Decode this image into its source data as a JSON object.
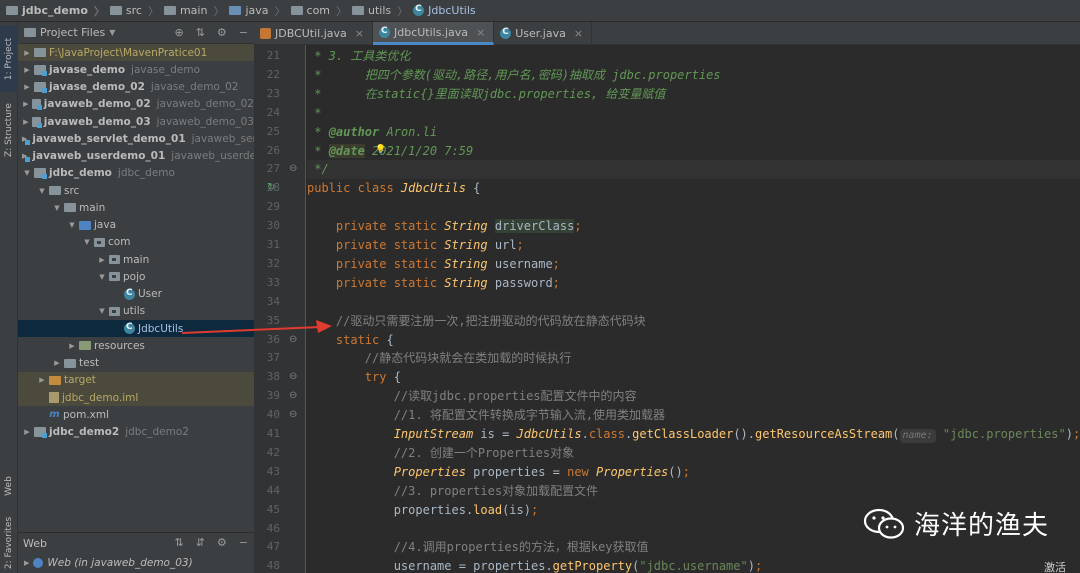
{
  "breadcrumb": [
    "jdbc_demo",
    "src",
    "main",
    "java",
    "com",
    "utils",
    "JdbcUtils"
  ],
  "stripe": {
    "project_tab": "1: Project",
    "structure_tab": "Z: Structure",
    "web_tab": "Web",
    "favorites_tab": "2: Favorites"
  },
  "project_panel": {
    "title": "Project Files",
    "tree": [
      {
        "label": "F:\\JavaProject\\MavenPratice01",
        "module": "",
        "depth": 0,
        "arrow": "right",
        "icon": "folder",
        "bold": false,
        "state": "highlight"
      },
      {
        "label": "javase_demo",
        "module": "javase_demo",
        "depth": 0,
        "arrow": "right",
        "icon": "module",
        "bold": true
      },
      {
        "label": "javase_demo_02",
        "module": "javase_demo_02",
        "depth": 0,
        "arrow": "right",
        "icon": "module",
        "bold": true
      },
      {
        "label": "javaweb_demo_02",
        "module": "javaweb_demo_02",
        "depth": 0,
        "arrow": "right",
        "icon": "module",
        "bold": true
      },
      {
        "label": "javaweb_demo_03",
        "module": "javaweb_demo_03",
        "depth": 0,
        "arrow": "right",
        "icon": "module",
        "bold": true
      },
      {
        "label": "javaweb_servlet_demo_01",
        "module": "javaweb_servle",
        "depth": 0,
        "arrow": "right",
        "icon": "module",
        "bold": true
      },
      {
        "label": "javaweb_userdemo_01",
        "module": "javaweb_userdem",
        "depth": 0,
        "arrow": "right",
        "icon": "module",
        "bold": true
      },
      {
        "label": "jdbc_demo",
        "module": "jdbc_demo",
        "depth": 0,
        "arrow": "down",
        "icon": "module",
        "bold": true
      },
      {
        "label": "src",
        "module": "",
        "depth": 1,
        "arrow": "down",
        "icon": "folder"
      },
      {
        "label": "main",
        "module": "",
        "depth": 2,
        "arrow": "down",
        "icon": "folder"
      },
      {
        "label": "java",
        "module": "",
        "depth": 3,
        "arrow": "down",
        "icon": "folder-blue"
      },
      {
        "label": "com",
        "module": "",
        "depth": 4,
        "arrow": "down",
        "icon": "package"
      },
      {
        "label": "main",
        "module": "",
        "depth": 5,
        "arrow": "right",
        "icon": "package"
      },
      {
        "label": "pojo",
        "module": "",
        "depth": 5,
        "arrow": "down",
        "icon": "package"
      },
      {
        "label": "User",
        "module": "",
        "depth": 6,
        "arrow": "none",
        "icon": "class"
      },
      {
        "label": "utils",
        "module": "",
        "depth": 5,
        "arrow": "down",
        "icon": "package"
      },
      {
        "label": "JdbcUtils",
        "module": "",
        "depth": 6,
        "arrow": "none",
        "icon": "class",
        "state": "selected"
      },
      {
        "label": "resources",
        "module": "",
        "depth": 3,
        "arrow": "right",
        "icon": "folder-res"
      },
      {
        "label": "test",
        "module": "",
        "depth": 2,
        "arrow": "right",
        "icon": "folder"
      },
      {
        "label": "target",
        "module": "",
        "depth": 1,
        "arrow": "right",
        "icon": "folder-orange",
        "state": "highlight"
      },
      {
        "label": "jdbc_demo.iml",
        "module": "",
        "depth": 1,
        "arrow": "none",
        "icon": "iml",
        "state": "highlight"
      },
      {
        "label": "pom.xml",
        "module": "",
        "depth": 1,
        "arrow": "none",
        "icon": "maven"
      },
      {
        "label": "jdbc_demo2",
        "module": "jdbc_demo2",
        "depth": 0,
        "arrow": "right",
        "icon": "module",
        "bold": true
      }
    ]
  },
  "web_panel": {
    "title": "Web",
    "item": "Web (in javaweb_demo_03)"
  },
  "tabs": [
    {
      "label": "JDBCUtil.java",
      "icon": "java-file",
      "active": false
    },
    {
      "label": "JdbcUtils.java",
      "icon": "class",
      "active": true
    },
    {
      "label": "User.java",
      "icon": "class",
      "active": false
    }
  ],
  "editor": {
    "lines": [
      {
        "n": "21",
        "html": "<span class='dc'> * 3. 工具类优化</span>"
      },
      {
        "n": "22",
        "html": "<span class='dc'> *      把四个参数(驱动,路径,用户名,密码)抽取成 jdbc.properties</span>"
      },
      {
        "n": "23",
        "html": "<span class='dc'> *      在static{}里面读取jdbc.properties, 给变量赋值</span>"
      },
      {
        "n": "24",
        "html": "<span class='dc'> *</span>"
      },
      {
        "n": "25",
        "html": "<span class='dc'> * </span><span class='tag'>@author</span><span class='dc'> Aron.li</span>"
      },
      {
        "n": "26",
        "html": "<span class='dc'> * </span><span class='tag' style='background:#3b3b2e'>@date</span><span class='dc'> 2021/1/20 7:59</span>"
      },
      {
        "n": "27",
        "html": "<span class='dc'> */</span>"
      },
      {
        "n": "28",
        "html": "<span class='kw'>public class </span><span class='ity'>JdbcUtils</span> {"
      },
      {
        "n": "29",
        "html": ""
      },
      {
        "n": "30",
        "html": "    <span class='kw'>private static </span><span class='ity'>String</span> <span class='hlvar'>driverClass</span><span class='kw'>;</span>"
      },
      {
        "n": "31",
        "html": "    <span class='kw'>private static </span><span class='ity'>String</span> url<span class='kw'>;</span>"
      },
      {
        "n": "32",
        "html": "    <span class='kw'>private static </span><span class='ity'>String</span> username<span class='kw'>;</span>"
      },
      {
        "n": "33",
        "html": "    <span class='kw'>private static </span><span class='ity'>String</span> password<span class='kw'>;</span>"
      },
      {
        "n": "34",
        "html": ""
      },
      {
        "n": "35",
        "html": "    <span class='cm'>//驱动只需要注册一次,把注册驱动的代码放在静态代码块</span>"
      },
      {
        "n": "36",
        "html": "    <span class='kw'>static</span> {"
      },
      {
        "n": "37",
        "html": "        <span class='cm'>//静态代码块就会在类加载的时候执行</span>"
      },
      {
        "n": "38",
        "html": "        <span class='kw'>try</span> {"
      },
      {
        "n": "39",
        "html": "            <span class='cm'>//读取jdbc.properties配置文件中的内容</span>"
      },
      {
        "n": "40",
        "html": "            <span class='cm'>//1. 将配置文件转换成字节输入流,使用类加载器</span>"
      },
      {
        "n": "41",
        "html": "            <span class='ity'>InputStream</span> is = <span class='ity'>JdbcUtils</span>.<span class='kw'>class</span>.<span class='mth'>getClassLoader</span>().<span class='mth'>getResourceAsStream</span>(<span class='hintlbl'>name:</span> <span class='str'>\"jdbc.properties\"</span>)<span class='kw'>;</span>"
      },
      {
        "n": "42",
        "html": "            <span class='cm'>//2. 创建一个Properties对象</span>"
      },
      {
        "n": "43",
        "html": "            <span class='ity'>Properties</span> properties = <span class='kw'>new </span><span class='ity'>Properties</span>()<span class='kw'>;</span>"
      },
      {
        "n": "44",
        "html": "            <span class='cm'>//3. properties对象加载配置文件</span>"
      },
      {
        "n": "45",
        "html": "            properties.<span class='mth'>load</span>(is)<span class='kw'>;</span>"
      },
      {
        "n": "46",
        "html": ""
      },
      {
        "n": "47",
        "html": "            <span class='cm'>//4.调用properties的方法，根据key获取值</span>"
      },
      {
        "n": "48",
        "html": "            username = properties.<span class='mth'>getProperty</span>(<span class='str'>\"jdbc.username\"</span>)<span class='kw'>;</span>"
      }
    ],
    "current_line": "27"
  },
  "watermark": {
    "text": "海洋的渔夫",
    "corner": "激活"
  },
  "colors": {
    "editor_bg": "#2b2b2b",
    "panel_bg": "#3c3f41",
    "selection": "#0d293e",
    "keyword": "#cc7832",
    "arrow": "#e03b2f"
  }
}
